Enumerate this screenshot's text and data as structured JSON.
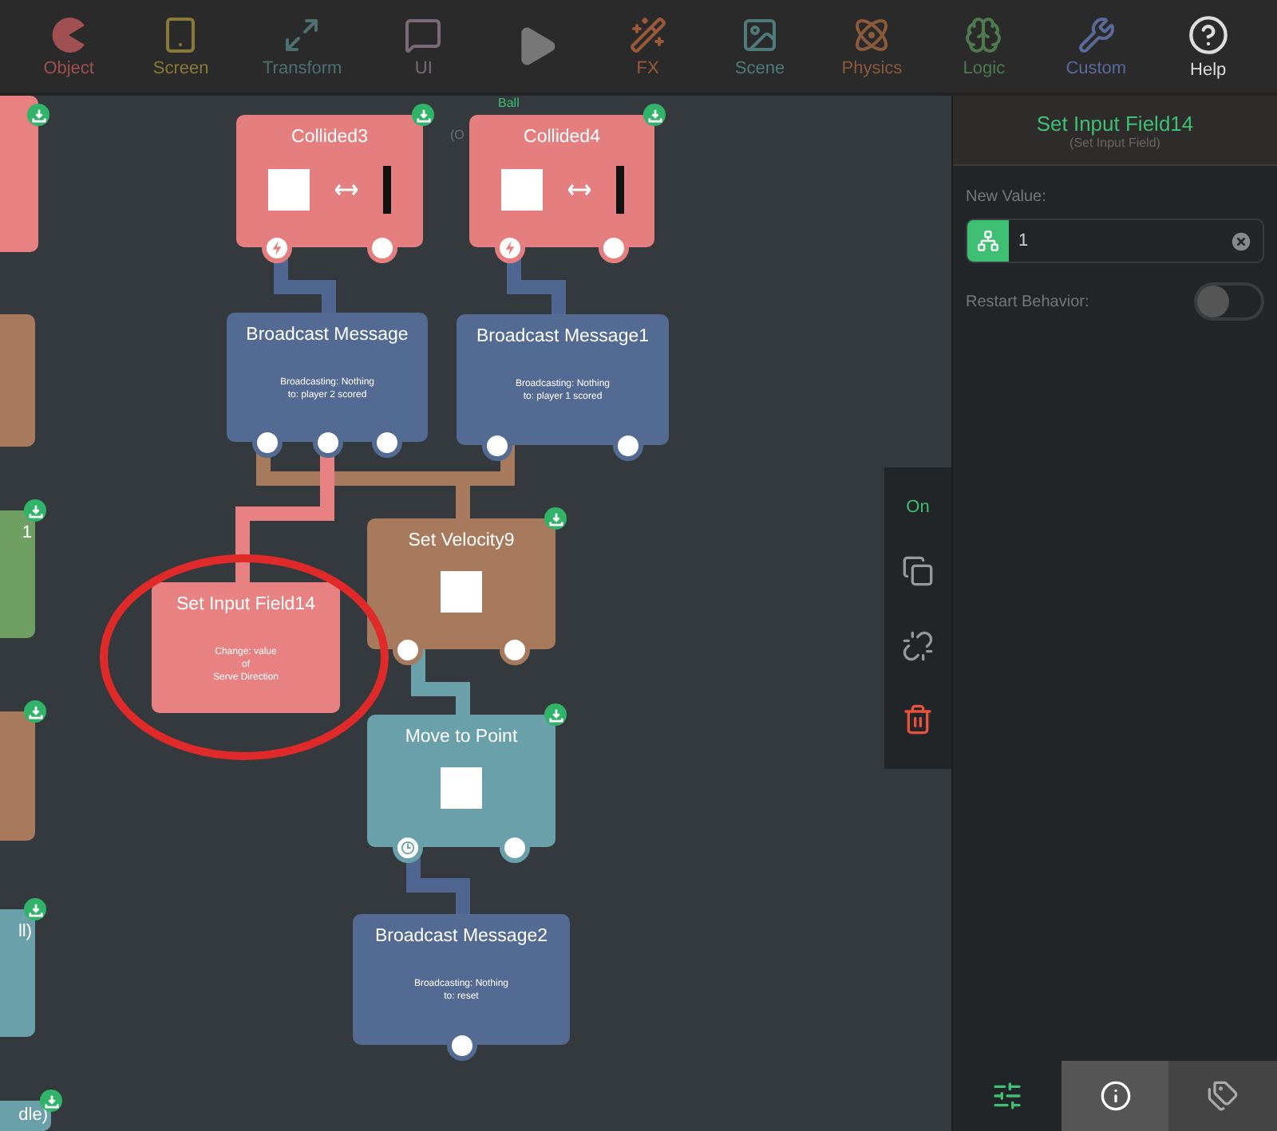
{
  "toolbar": {
    "tools": [
      {
        "kind": "object",
        "label": "Object",
        "dimmed": true
      },
      {
        "kind": "screen",
        "label": "Screen",
        "dimmed": true
      },
      {
        "kind": "transform",
        "label": "Transform",
        "dimmed": true
      },
      {
        "kind": "ui",
        "label": "UI",
        "dimmed": true
      },
      {
        "kind": "play",
        "dimmed": true
      },
      {
        "kind": "fx",
        "label": "FX",
        "dimmed": true
      },
      {
        "kind": "scene",
        "label": "Scene",
        "dimmed": true
      },
      {
        "kind": "physics",
        "label": "Physics",
        "dimmed": true
      },
      {
        "kind": "logic",
        "label": "Logic",
        "dimmed": true
      },
      {
        "kind": "custom",
        "label": "Custom",
        "dimmed": true
      },
      {
        "kind": "help",
        "label": "Help",
        "dimmed": false
      }
    ]
  },
  "canvas": {
    "labels": [
      {
        "text": "Ball",
        "color": "#3fbf74"
      },
      {
        "text": "(O",
        "color": "#6b7075"
      }
    ],
    "edge_nodes": [
      {
        "color": "#e88282",
        "badge": true
      },
      {
        "color": "#a77a5d",
        "badge": false
      },
      {
        "color": "#6f9f63",
        "badge": true,
        "label": "1"
      },
      {
        "color": "#a77a5d",
        "badge": true
      },
      {
        "color": "#6aa0a9",
        "badge": true,
        "label": "ll)"
      },
      {
        "color": "#6aa0a9",
        "badge": true,
        "label": "dle)"
      }
    ],
    "nodes": [
      {
        "title": "Collided3",
        "kind": "collision",
        "color": "#e57f7f",
        "badge": true,
        "ports": [
          {
            "kind": "trigger"
          },
          {
            "kind": "plain"
          }
        ]
      },
      {
        "title": "Collided4",
        "kind": "collision",
        "color": "#e57f7f",
        "badge": true,
        "ports": [
          {
            "kind": "trigger"
          },
          {
            "kind": "plain"
          }
        ]
      },
      {
        "title": "Broadcast Message",
        "kind": "text",
        "color": "#536a92",
        "badge": false,
        "body": [
          "Broadcasting: Nothing",
          "to: player 2 scored"
        ],
        "ports": [
          {
            "kind": "plain"
          },
          {
            "kind": "plain"
          },
          {
            "kind": "plain"
          }
        ]
      },
      {
        "title": "Broadcast Message1",
        "kind": "text",
        "color": "#536a92",
        "badge": false,
        "body": [
          "Broadcasting: Nothing",
          "to: player 1 scored"
        ],
        "ports": [
          {
            "kind": "plain"
          },
          {
            "kind": "plain"
          }
        ]
      },
      {
        "title": "Set Input Field14",
        "kind": "text",
        "color": "#e88282",
        "badge": false,
        "body": [
          "Change: value",
          "of",
          "Serve Direction"
        ]
      },
      {
        "title": "Set Velocity9",
        "kind": "square",
        "color": "#a77a5d",
        "badge": true,
        "ports": [
          {
            "kind": "plain"
          },
          {
            "kind": "plain"
          }
        ]
      },
      {
        "title": "Move to Point",
        "kind": "square",
        "color": "#6aa0a9",
        "badge": true,
        "ports": [
          {
            "kind": "clock"
          },
          {
            "kind": "plain"
          }
        ]
      },
      {
        "title": "Broadcast Message2",
        "kind": "text",
        "color": "#536a92",
        "badge": false,
        "body": [
          "Broadcasting: Nothing",
          "to: reset"
        ],
        "ports": [
          {
            "kind": "plain"
          }
        ]
      }
    ],
    "highlight": {
      "kind": "ellipse"
    }
  },
  "side_tools": {
    "status": "On",
    "items": [
      {
        "kind": "copy"
      },
      {
        "kind": "unlink"
      },
      {
        "kind": "delete"
      }
    ]
  },
  "panel": {
    "title": "Set Input Field14",
    "subtitle": "(Set Input Field)",
    "fields": [
      {
        "kind": "input",
        "label": "New Value:",
        "value": "1"
      },
      {
        "kind": "toggle",
        "label": "Restart Behavior:",
        "on": false
      }
    ],
    "tabs": [
      {
        "kind": "properties",
        "selected": false
      },
      {
        "kind": "info",
        "selected": true
      },
      {
        "kind": "tags",
        "selected": false
      }
    ]
  }
}
